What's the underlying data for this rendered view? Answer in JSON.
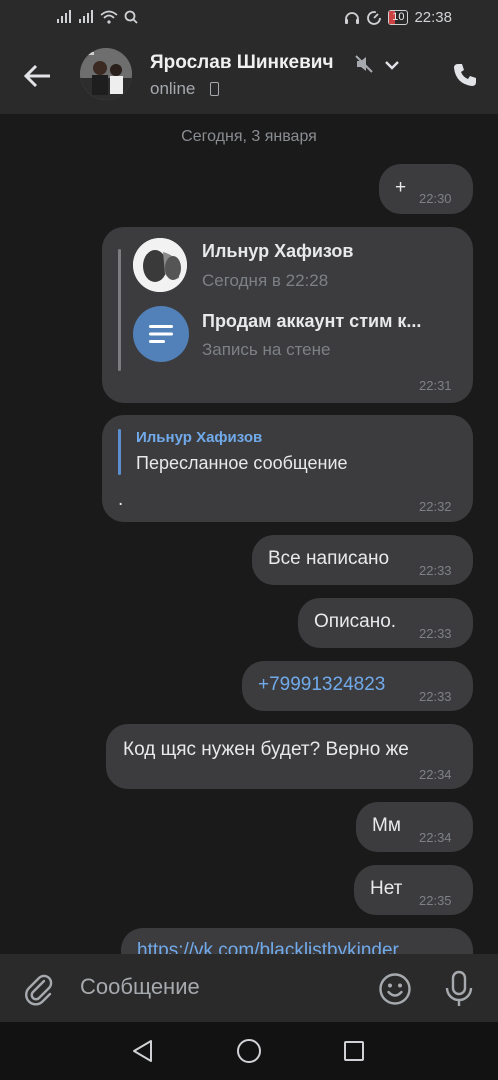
{
  "status_bar": {
    "time": "22:38",
    "battery": "10"
  },
  "header": {
    "name": "Ярослав Шинкевич",
    "status": "online"
  },
  "chat": {
    "date_divider": "Сегодня, 3 января",
    "messages": [
      {
        "text": "+",
        "time": "22:30"
      },
      {
        "forward": {
          "author": "Ильнур Хафизов",
          "date": "Сегодня в 22:28",
          "post_title": "Продам аккаунт стим к...",
          "post_subtitle": "Запись на стене"
        },
        "time": "22:31"
      },
      {
        "reply_author": "Ильнур Хафизов",
        "reply_text": "Пересланное сообщение",
        "text": ".",
        "time": "22:32"
      },
      {
        "text": "Все написано",
        "time": "22:33"
      },
      {
        "text": "Описано.",
        "time": "22:33"
      },
      {
        "text": "+79991324823",
        "time": "22:33"
      },
      {
        "text": "Код щяс нужен будет? Верно же",
        "time": "22:34"
      },
      {
        "text": "Мм",
        "time": "22:34"
      },
      {
        "text": "Нет",
        "time": "22:35"
      },
      {
        "text": "https://vk.com/blacklistbykinder"
      }
    ]
  },
  "input": {
    "placeholder": "Сообщение"
  }
}
